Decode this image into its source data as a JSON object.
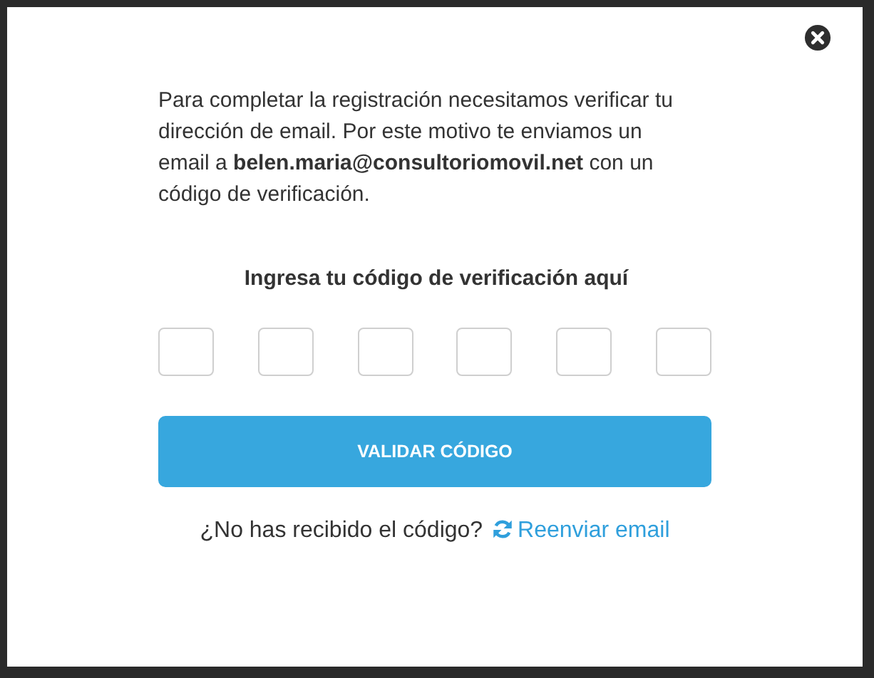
{
  "dialog": {
    "message": "Para completar la registración necesitamos verificar tu dirección de email. Por este motivo te enviamos un email a **belen.maria@consultoriomovil.net** con un código de verificación.",
    "code_label": "Ingresa tu código de verificación aquí",
    "code_fields": [
      {
        "kind": "digit"
      },
      {
        "kind": "digit"
      },
      {
        "kind": "digit"
      },
      {
        "kind": "digit"
      },
      {
        "kind": "digit"
      },
      {
        "kind": "digit"
      }
    ],
    "submit_button": "VALIDAR CÓDIGO",
    "resend_prompt": "¿No has recibido el código?",
    "resend_link": "Reenviar email"
  }
}
